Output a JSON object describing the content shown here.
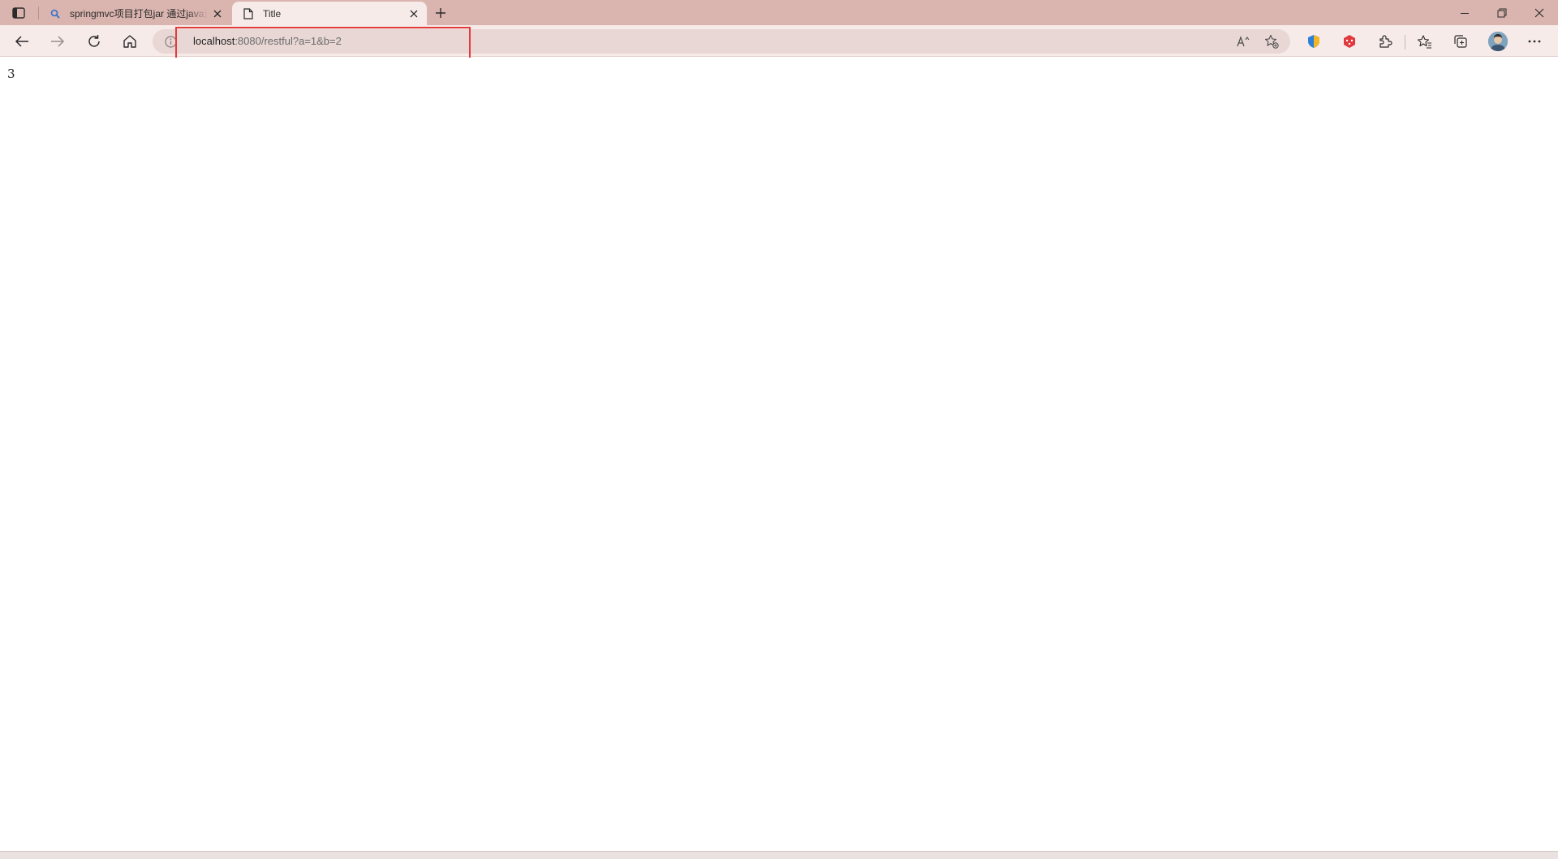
{
  "browser": {
    "tabs": [
      {
        "title": "springmvc项目打包jar 通过java运行",
        "icon": "search-icon",
        "active": false
      },
      {
        "title": "Title",
        "icon": "page-icon",
        "active": true
      }
    ],
    "address": {
      "host": "localhost",
      "rest": ":8080/restful?a=1&b=2"
    },
    "colors": {
      "titlebar": "#dab4ae",
      "toolbar": "#f6ebe8",
      "highlight": "#e33b3b"
    }
  },
  "page": {
    "result": "3"
  }
}
